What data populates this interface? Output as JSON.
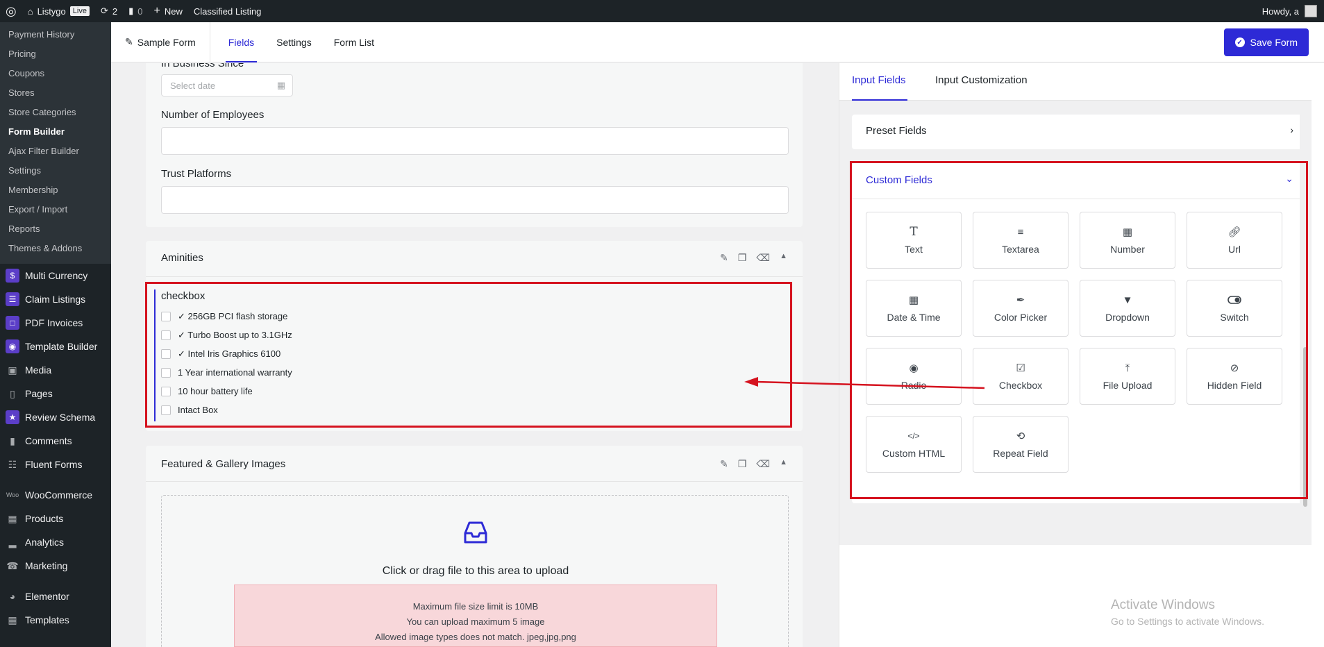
{
  "admin_bar": {
    "site_name": "Listygo",
    "live_badge": "Live",
    "updates_count": "2",
    "comments_count": "0",
    "new_label": "New",
    "classified_label": "Classified Listing",
    "howdy": "Howdy, a"
  },
  "sidebar": {
    "submenu": [
      "Payment History",
      "Pricing",
      "Coupons",
      "Stores",
      "Store Categories",
      "Form Builder",
      "Ajax Filter Builder",
      "Settings",
      "Membership",
      "Export / Import",
      "Reports",
      "Themes & Addons"
    ],
    "current_submenu": "Form Builder",
    "menu": [
      {
        "label": "Multi Currency",
        "icon": "dollar-icon"
      },
      {
        "label": "Claim Listings",
        "icon": "claim-icon"
      },
      {
        "label": "PDF Invoices",
        "icon": "pdf-icon"
      },
      {
        "label": "Template Builder",
        "icon": "template-icon"
      },
      {
        "label": "Media",
        "icon": "media-icon"
      },
      {
        "label": "Pages",
        "icon": "pages-icon"
      },
      {
        "label": "Review Schema",
        "icon": "review-icon"
      },
      {
        "label": "Comments",
        "icon": "comment-icon"
      },
      {
        "label": "Fluent Forms",
        "icon": "forms-icon"
      },
      {
        "label": "WooCommerce",
        "icon": "woo-icon"
      },
      {
        "label": "Products",
        "icon": "products-icon"
      },
      {
        "label": "Analytics",
        "icon": "analytics-icon"
      },
      {
        "label": "Marketing",
        "icon": "marketing-icon"
      },
      {
        "label": "Elementor",
        "icon": "elementor-icon"
      },
      {
        "label": "Templates",
        "icon": "templates-icon"
      }
    ]
  },
  "header": {
    "form_name": "Sample Form",
    "tabs": [
      "Fields",
      "Settings",
      "Form List"
    ],
    "active_tab": "Fields",
    "save_label": "Save Form"
  },
  "form": {
    "partial_label": "In Business Since",
    "date_placeholder": "Select date",
    "employees_label": "Number of Employees",
    "trust_label": "Trust Platforms",
    "aminities_title": "Aminities",
    "checkbox_label": "checkbox",
    "checkbox_options": [
      "✓ 256GB PCI flash storage",
      "✓ Turbo Boost up to 3.1GHz",
      "✓ Intel Iris Graphics 6100",
      "1 Year international warranty",
      "10 hour battery life",
      "Intact Box"
    ],
    "gallery_title": "Featured & Gallery Images",
    "upload_text": "Click or drag file to this area to upload",
    "upload_errors": [
      "Maximum file size limit is 10MB",
      "You can upload maximum 5 image",
      "Allowed image types does not match. jpeg,jpg,png"
    ]
  },
  "right_panel": {
    "tabs": [
      "Input Fields",
      "Input Customization"
    ],
    "active_tab": "Input Fields",
    "preset_label": "Preset Fields",
    "custom_label": "Custom Fields",
    "custom_fields": [
      {
        "label": "Text",
        "icon": "text-icon"
      },
      {
        "label": "Textarea",
        "icon": "textarea-icon"
      },
      {
        "label": "Number",
        "icon": "calculator-icon"
      },
      {
        "label": "Url",
        "icon": "link-icon"
      },
      {
        "label": "Date & Time",
        "icon": "calendar-icon"
      },
      {
        "label": "Color Picker",
        "icon": "eyedropper-icon"
      },
      {
        "label": "Dropdown",
        "icon": "dropdown-icon"
      },
      {
        "label": "Switch",
        "icon": "toggle-icon"
      },
      {
        "label": "Radio",
        "icon": "radio-icon"
      },
      {
        "label": "Checkbox",
        "icon": "checkbox-icon"
      },
      {
        "label": "File Upload",
        "icon": "upload-icon"
      },
      {
        "label": "Hidden Field",
        "icon": "eye-slash-icon"
      },
      {
        "label": "Custom HTML",
        "icon": "code-icon"
      },
      {
        "label": "Repeat Field",
        "icon": "repeat-icon"
      }
    ]
  },
  "watermark": {
    "line1": "Activate Windows",
    "line2": "Go to Settings to activate Windows."
  },
  "colors": {
    "accent": "#2d2ad6",
    "annotation_red": "#d5131f",
    "admin_dark": "#1d2327"
  }
}
